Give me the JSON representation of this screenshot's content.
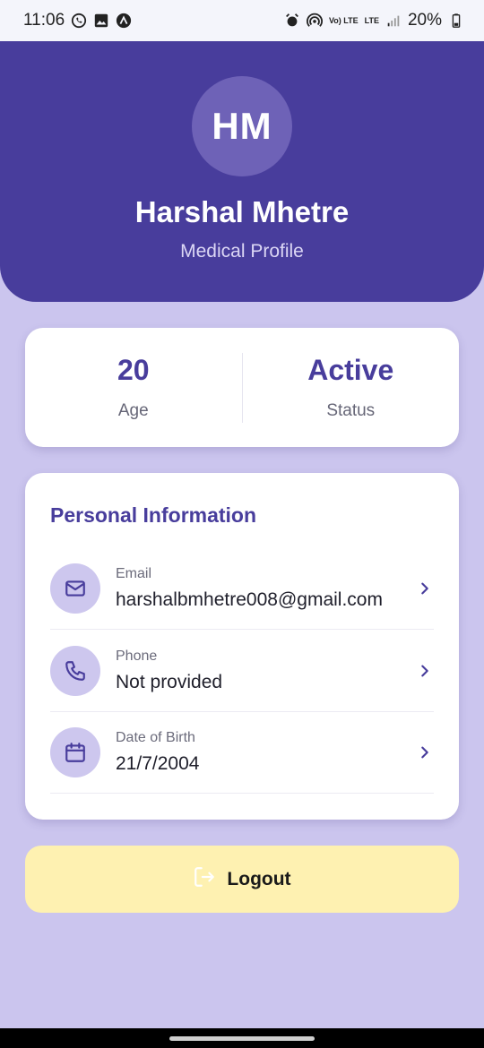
{
  "status_bar": {
    "time": "11:06",
    "battery": "20%",
    "icons_left": [
      "whatsapp-icon",
      "gallery-icon",
      "app-icon"
    ],
    "icons_right": [
      "alarm-icon",
      "hotspot-icon",
      "volte-icon",
      "lte-icon",
      "signal-icon",
      "battery-icon"
    ],
    "volte_text": "Vo) LTE",
    "lte_text": "LTE"
  },
  "header": {
    "initials": "HM",
    "name": "Harshal Mhetre",
    "subtitle": "Medical Profile",
    "background": "#483d9c"
  },
  "stats": [
    {
      "value": "20",
      "label": "Age"
    },
    {
      "value": "Active",
      "label": "Status"
    }
  ],
  "personal_info": {
    "title": "Personal Information",
    "rows": [
      {
        "icon": "mail-icon",
        "label": "Email",
        "value": "harshalbmhetre008@gmail.com"
      },
      {
        "icon": "phone-icon",
        "label": "Phone",
        "value": "Not provided"
      },
      {
        "icon": "calendar-icon",
        "label": "Date of Birth",
        "value": "21/7/2004"
      }
    ]
  },
  "logout": {
    "label": "Logout",
    "icon": "logout-icon",
    "background": "#fef1b1"
  },
  "colors": {
    "primary": "#483d9c",
    "page_background": "#cbc5ee",
    "icon_circle": "#cdc7ee"
  }
}
